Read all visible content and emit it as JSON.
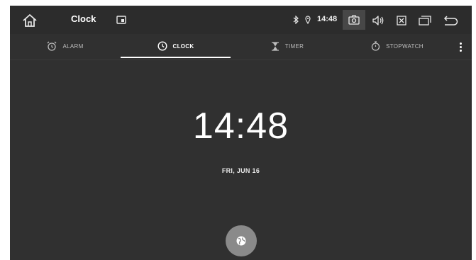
{
  "status_bar": {
    "app_title": "Clock",
    "time": "14:48",
    "icons": [
      "home-icon",
      "screen-icon",
      "bluetooth-icon",
      "location-icon",
      "camera-icon",
      "volume-icon",
      "close-icon",
      "recent-apps-icon",
      "back-icon"
    ]
  },
  "tabs": [
    {
      "label": "ALARM",
      "icon": "alarm-icon",
      "active": false
    },
    {
      "label": "CLOCK",
      "icon": "clock-icon",
      "active": true
    },
    {
      "label": "TIMER",
      "icon": "hourglass-icon",
      "active": false
    },
    {
      "label": "STOPWATCH",
      "icon": "stopwatch-icon",
      "active": false
    }
  ],
  "clock": {
    "time": "14:48",
    "date": "FRI, JUN 16"
  },
  "fab": {
    "icon": "globe-icon"
  },
  "colors": {
    "background": "#303030",
    "status_bar": "#2c2c2c",
    "text": "#ffffff",
    "fab": "#8a8a8a"
  }
}
